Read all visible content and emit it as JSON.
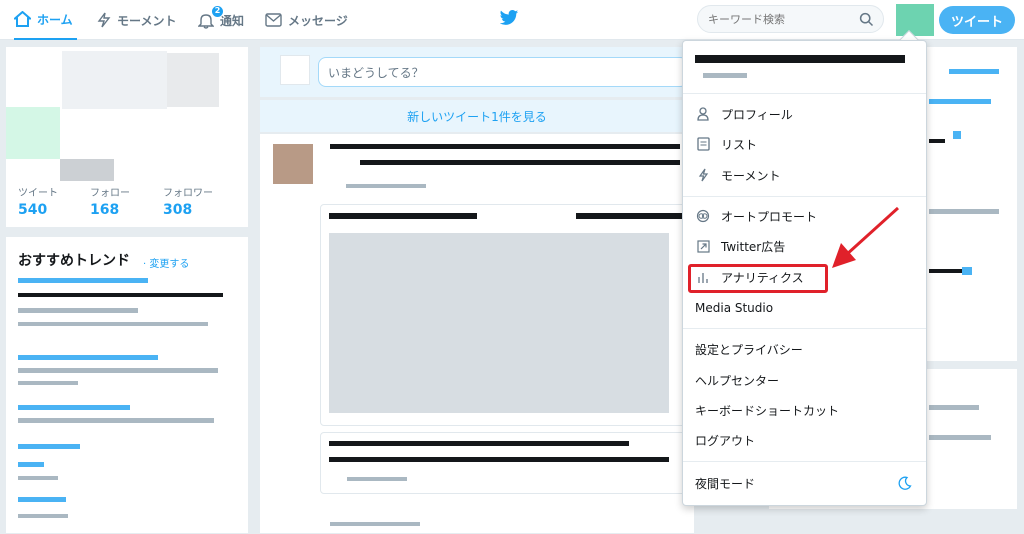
{
  "nav": {
    "home": "ホーム",
    "moments": "モーメント",
    "notifications": "通知",
    "notifications_count": "2",
    "messages": "メッセージ"
  },
  "search": {
    "placeholder": "キーワード検索"
  },
  "tweet_button": "ツイート",
  "profile": {
    "stats": [
      {
        "label": "ツイート",
        "value": "540"
      },
      {
        "label": "フォロー",
        "value": "168"
      },
      {
        "label": "フォロワー",
        "value": "308"
      }
    ]
  },
  "trends": {
    "title": "おすすめトレンド",
    "change": "· 変更する"
  },
  "compose": {
    "placeholder": "いまどうしてる？"
  },
  "new_tweets": "新しいツイート1件を見る",
  "menu": {
    "items_group1": [
      "プロフィール",
      "リスト",
      "モーメント"
    ],
    "items_group2": [
      "オートプロモート",
      "Twitter広告",
      "アナリティクス",
      "Media Studio"
    ],
    "items_group3": [
      "設定とプライバシー",
      "ヘルプセンター",
      "キーボードショートカット",
      "ログアウト"
    ],
    "night_mode": "夜間モード"
  },
  "colors": {
    "brand": "#1da1f2",
    "highlight": "#e0212a"
  }
}
